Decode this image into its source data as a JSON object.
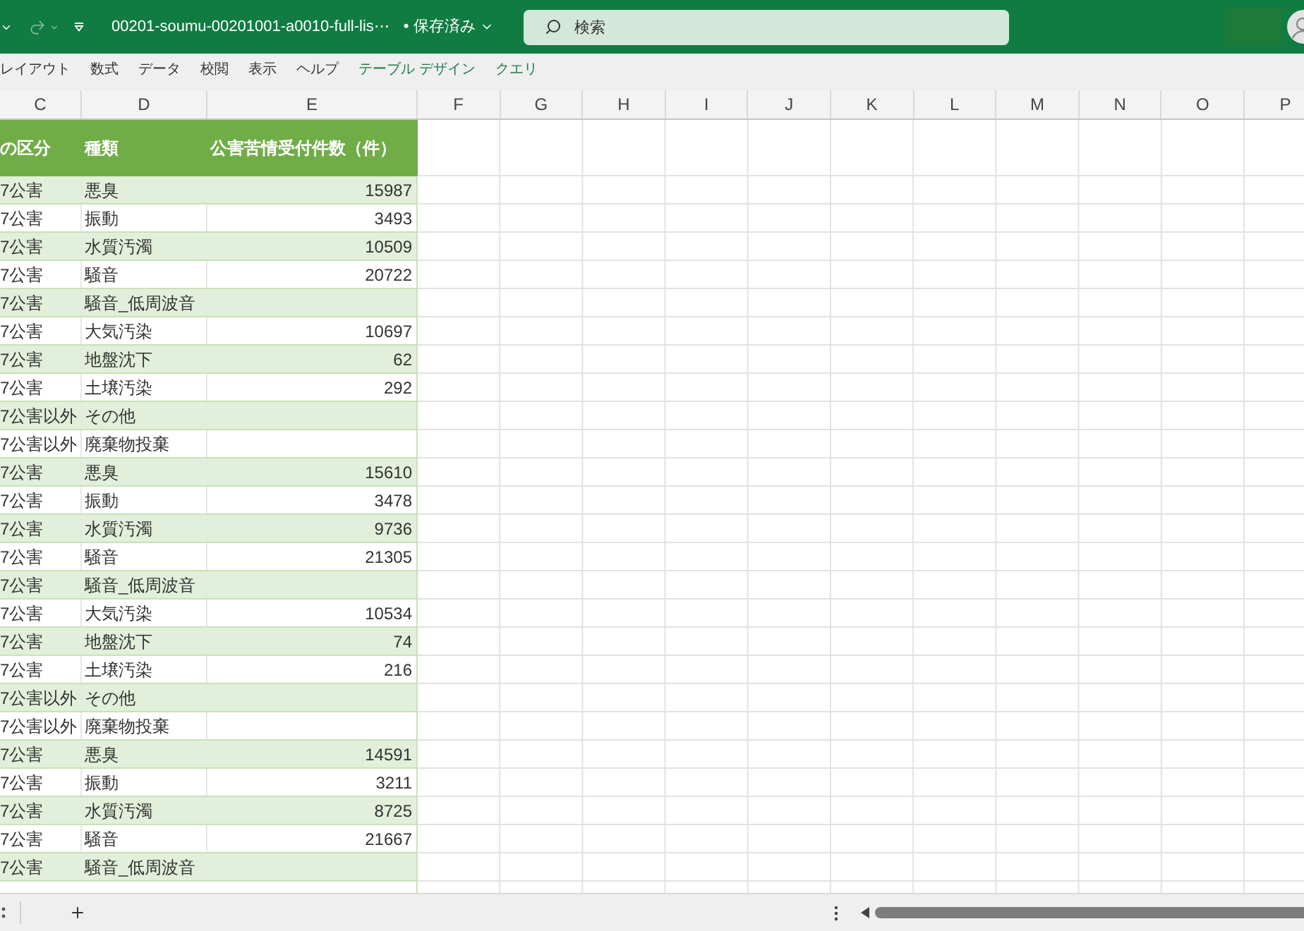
{
  "title_bar": {
    "file_name": "00201-soumu-00201001-a0010-full-lis⋯",
    "save_status": "• 保存済み",
    "search": {
      "placeholder": "検索"
    }
  },
  "ribbon_tabs": [
    {
      "label": "レイアウト",
      "kind": "standard",
      "selected": false
    },
    {
      "label": "数式",
      "kind": "standard",
      "selected": false
    },
    {
      "label": "データ",
      "kind": "standard",
      "selected": false
    },
    {
      "label": "校閲",
      "kind": "standard",
      "selected": false
    },
    {
      "label": "表示",
      "kind": "standard",
      "selected": false
    },
    {
      "label": "ヘルプ",
      "kind": "standard",
      "selected": false
    },
    {
      "label": "テーブル デザイン",
      "kind": "contextual",
      "selected": false
    },
    {
      "label": "クエリ",
      "kind": "contextual",
      "selected": false
    }
  ],
  "column_headers": [
    "C",
    "D",
    "E",
    "F",
    "G",
    "H",
    "I",
    "J",
    "K",
    "L",
    "M",
    "N",
    "O",
    "P"
  ],
  "table": {
    "columns": [
      "の区分",
      "種類",
      "公害苦情受付件数（件）"
    ],
    "rows": [
      {
        "category": "7公害",
        "type": "悪臭",
        "count": "15987"
      },
      {
        "category": "7公害",
        "type": "振動",
        "count": "3493"
      },
      {
        "category": "7公害",
        "type": "水質汚濁",
        "count": "10509"
      },
      {
        "category": "7公害",
        "type": "騒音",
        "count": "20722"
      },
      {
        "category": "7公害",
        "type": "騒音_低周波音"
      },
      {
        "category": "7公害",
        "type": "大気汚染",
        "count": "10697"
      },
      {
        "category": "7公害",
        "type": "地盤沈下",
        "count": "62"
      },
      {
        "category": "7公害",
        "type": "土壌汚染",
        "count": "292"
      },
      {
        "category": "7公害以外",
        "type": "その他"
      },
      {
        "category": "7公害以外",
        "type": "廃棄物投棄"
      },
      {
        "category": "7公害",
        "type": "悪臭",
        "count": "15610"
      },
      {
        "category": "7公害",
        "type": "振動",
        "count": "3478"
      },
      {
        "category": "7公害",
        "type": "水質汚濁",
        "count": "9736"
      },
      {
        "category": "7公害",
        "type": "騒音",
        "count": "21305"
      },
      {
        "category": "7公害",
        "type": "騒音_低周波音"
      },
      {
        "category": "7公害",
        "type": "大気汚染",
        "count": "10534"
      },
      {
        "category": "7公害",
        "type": "地盤沈下",
        "count": "74"
      },
      {
        "category": "7公害",
        "type": "土壌汚染",
        "count": "216"
      },
      {
        "category": "7公害以外",
        "type": "その他"
      },
      {
        "category": "7公害以外",
        "type": "廃棄物投棄"
      },
      {
        "category": "7公害",
        "type": "悪臭",
        "count": "14591"
      },
      {
        "category": "7公害",
        "type": "振動",
        "count": "3211"
      },
      {
        "category": "7公害",
        "type": "水質汚濁",
        "count": "8725"
      },
      {
        "category": "7公害",
        "type": "騒音",
        "count": "21667"
      },
      {
        "category": "7公害",
        "type": "騒音_低周波音"
      }
    ]
  }
}
